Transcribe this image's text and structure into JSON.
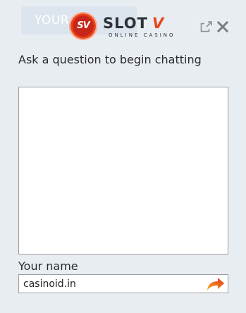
{
  "background_button": {
    "label": "YOUR"
  },
  "logo": {
    "badge_text": "SV",
    "word": "SLOT",
    "accent": "V",
    "subtitle": "ONLINE CASINO"
  },
  "icons": {
    "popout": "popout-icon",
    "close": "close-icon",
    "send": "send-arrow-icon"
  },
  "chat": {
    "prompt": "Ask a question to begin chatting",
    "messages": []
  },
  "name_field": {
    "label": "Your name",
    "value": "casinoid.in"
  },
  "colors": {
    "accent": "#e8471b",
    "background": "#e8edf2",
    "border": "#9c9c9c"
  }
}
